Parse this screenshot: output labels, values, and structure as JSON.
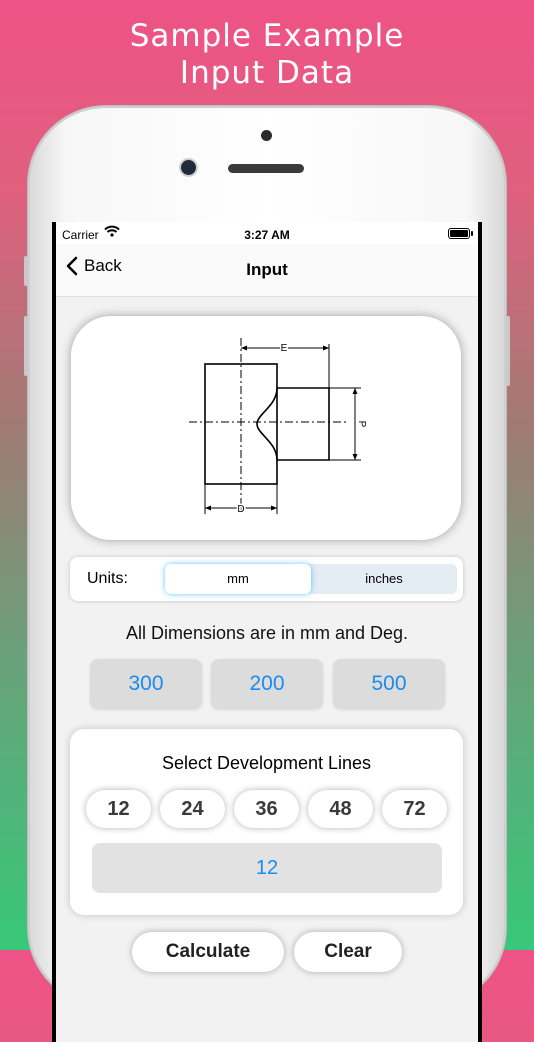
{
  "promo": {
    "line1": "Sample Example",
    "line2": "Input Data"
  },
  "status_bar": {
    "carrier": "Carrier",
    "time": "3:27 AM"
  },
  "navbar": {
    "back_label": "Back",
    "title": "Input"
  },
  "diagram": {
    "label_e": "E",
    "label_d": "D",
    "label_p": "P"
  },
  "units": {
    "label": "Units:",
    "options": [
      "mm",
      "inches"
    ],
    "selected": "mm"
  },
  "dimensions": {
    "label": "All Dimensions are in mm and Deg.",
    "values": [
      "300",
      "200",
      "500"
    ]
  },
  "development": {
    "title": "Select Development Lines",
    "options": [
      "12",
      "24",
      "36",
      "48",
      "72"
    ],
    "value": "12"
  },
  "actions": {
    "calculate_label": "Calculate",
    "clear_label": "Clear"
  },
  "colors": {
    "accent": "#1a8cf0",
    "gradient_top": "#ef5287",
    "gradient_bottom": "#37c879"
  }
}
